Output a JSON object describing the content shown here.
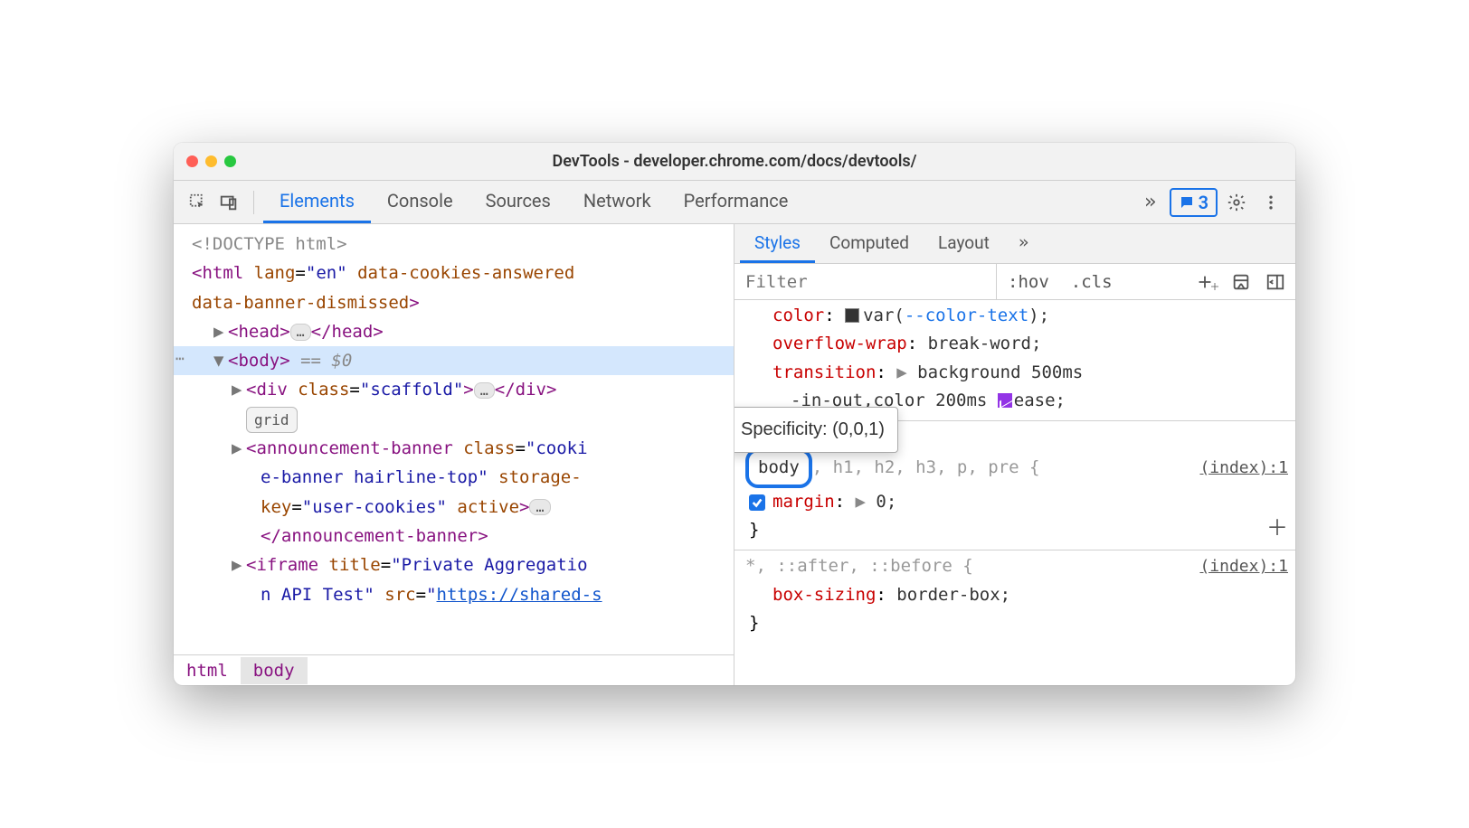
{
  "window": {
    "title": "DevTools - developer.chrome.com/docs/devtools/"
  },
  "toolbar": {
    "tabs": [
      "Elements",
      "Console",
      "Sources",
      "Network",
      "Performance"
    ],
    "active_tab": "Elements",
    "overflow": "»",
    "issues_count": "3"
  },
  "dom": {
    "doctype": "<!DOCTYPE html>",
    "html_open_1": "<html",
    "html_lang_name": "lang",
    "html_lang_val": "\"en\"",
    "html_attr2": "data-cookies-answered",
    "html_attr3": "data-banner-dismissed",
    "html_close": ">",
    "head_open": "<head>",
    "head_close": "</head>",
    "body_open": "<body>",
    "body_ref": " == $0",
    "div_open": "<div",
    "div_class_name": "class",
    "div_class_val": "\"scaffold\"",
    "div_close": "</div>",
    "grid_badge": "grid",
    "ann_open": "<announcement-banner",
    "ann_class_name": "class",
    "ann_class_val": "\"cookie-banner hairline-top\"",
    "ann_storage_name": "storage-key",
    "ann_storage_val": "\"user-cookies\"",
    "ann_active": "active",
    "ann_close": "</announcement-banner>",
    "iframe_open": "<iframe",
    "iframe_title_name": "title",
    "iframe_title_val": "\"Private Aggregation API Test\"",
    "iframe_src_name": "src",
    "iframe_src_val": "https://shared-s",
    "ellipsis": "…"
  },
  "breadcrumb": {
    "items": [
      "html",
      "body"
    ],
    "active": "body"
  },
  "styles": {
    "tabs": [
      "Styles",
      "Computed",
      "Layout"
    ],
    "active_tab": "Styles",
    "overflow": "»",
    "filter_placeholder": "Filter",
    "hov": ":hov",
    "cls": ".cls",
    "tooltip": "Specificity: (0,0,1)",
    "rule0": {
      "color_name": "color",
      "color_val_pre": "var(",
      "color_var": "--color-text",
      "color_val_post": ");",
      "overflow_name": "overflow-wrap",
      "overflow_val": "break-word;",
      "transition_name": "transition",
      "transition_val1": "background 500ms",
      "transition_val2": "-in-out,color 200ms",
      "transition_val3": "ease;"
    },
    "rule1": {
      "selector_main": "body",
      "selector_rest": ", h1, h2, h3, p, pre {",
      "source": "(index):1",
      "margin_name": "margin",
      "margin_val": "0;",
      "close": "}"
    },
    "rule2": {
      "selector": "*, ::after, ::before {",
      "source": "(index):1",
      "box_name": "box-sizing",
      "box_val": "border-box;",
      "close": "}"
    }
  }
}
